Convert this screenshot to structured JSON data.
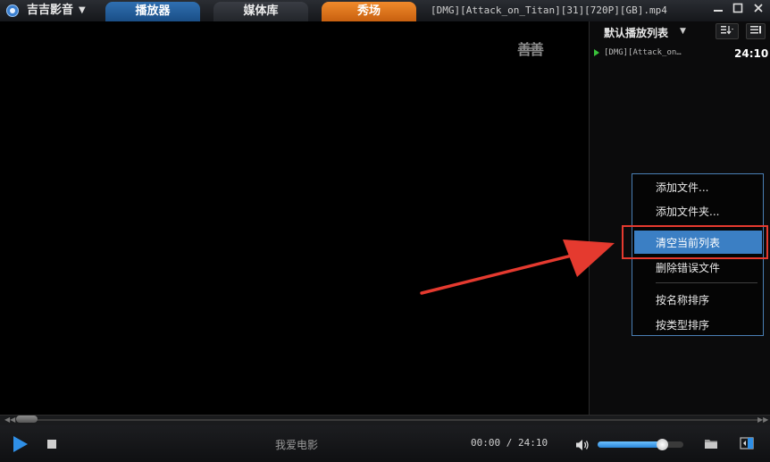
{
  "app": {
    "name": "吉吉影音"
  },
  "tabs": [
    {
      "label": "播放器"
    },
    {
      "label": "媒体库"
    },
    {
      "label": "秀场"
    }
  ],
  "window": {
    "file_title": "[DMG][Attack_on_Titan][31][720P][GB].mp4"
  },
  "video": {
    "overlay_text": "善善"
  },
  "playlist": {
    "title": "默认播放列表",
    "items": [
      {
        "name": "[DMG][Attack_on…",
        "duration": "24:10"
      }
    ]
  },
  "context_menu": {
    "items": [
      {
        "label": "添加文件..."
      },
      {
        "label": "添加文件夹..."
      },
      {
        "label": "清空当前列表"
      },
      {
        "label": "删除错误文件"
      },
      {
        "label": "按名称排序"
      },
      {
        "label": "按类型排序"
      }
    ],
    "highlighted_index": 2
  },
  "controls": {
    "favorite_text": "我爱电影",
    "current_time": "00:00",
    "separator": "/",
    "total_time": "24:10",
    "volume_percent": 75
  },
  "colors": {
    "accent": "#2f8fe6",
    "tab_active": "#2f6fb1",
    "tab_show": "#f08a2b",
    "menu_highlight": "#3b7fc4",
    "annotation": "#e53a2f",
    "playing_indicator": "#39c23a"
  }
}
